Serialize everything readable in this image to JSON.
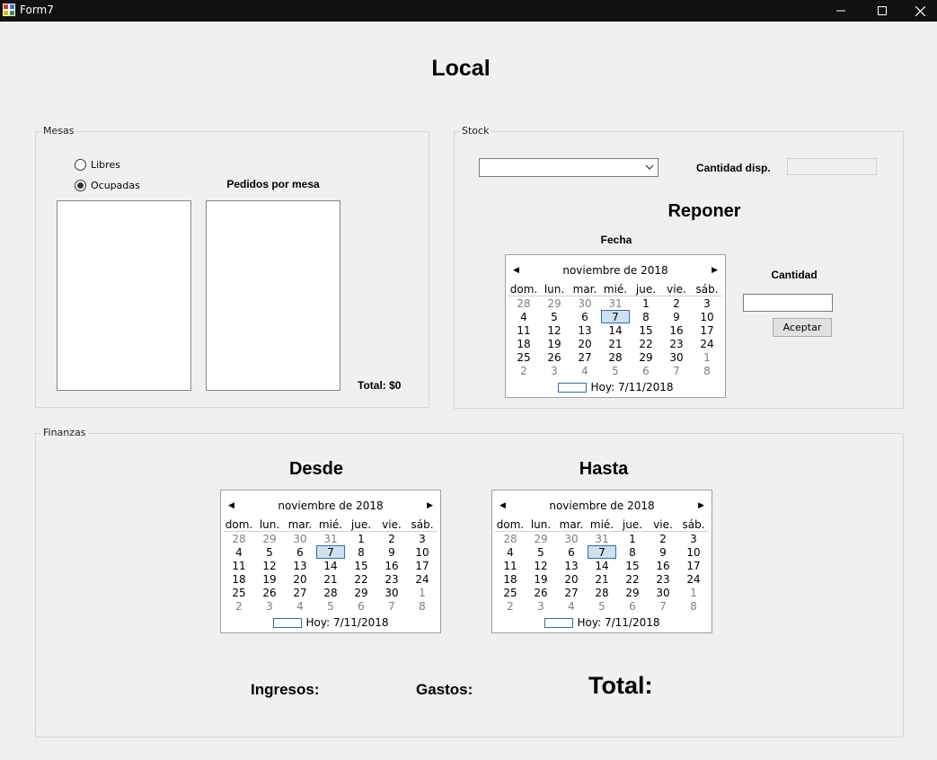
{
  "window": {
    "title": "Form7",
    "minimize_glyph": "—",
    "maximize_glyph": "☐",
    "close_glyph": "✕"
  },
  "page": {
    "heading": "Local"
  },
  "mesas": {
    "group_label": "Mesas",
    "radio_libres": "Libres",
    "radio_ocupadas": "Ocupadas",
    "selected": "Ocupadas",
    "pedidos_label": "Pedidos por mesa",
    "total_label": "Total: $0"
  },
  "stock": {
    "group_label": "Stock",
    "product_value": "",
    "cantidad_disp_label": "Cantidad disp.",
    "cantidad_disp_value": "",
    "reponer_heading": "Reponer",
    "fecha_label": "Fecha",
    "cantidad_label": "Cantidad",
    "cantidad_value": "",
    "aceptar_label": "Aceptar"
  },
  "finanzas": {
    "group_label": "Finanzas",
    "desde_heading": "Desde",
    "hasta_heading": "Hasta",
    "ingresos_label": "Ingresos:",
    "gastos_label": "Gastos:",
    "total_label": "Total:"
  },
  "calendar": {
    "month_label": "noviembre de 2018",
    "weekdays": [
      "dom.",
      "lun.",
      "mar.",
      "mié.",
      "jue.",
      "vie.",
      "sáb."
    ],
    "days": [
      {
        "d": "28",
        "other": true
      },
      {
        "d": "29",
        "other": true
      },
      {
        "d": "30",
        "other": true
      },
      {
        "d": "31",
        "other": true
      },
      {
        "d": "1"
      },
      {
        "d": "2"
      },
      {
        "d": "3"
      },
      {
        "d": "4"
      },
      {
        "d": "5"
      },
      {
        "d": "6"
      },
      {
        "d": "7",
        "today": true
      },
      {
        "d": "8"
      },
      {
        "d": "9"
      },
      {
        "d": "10"
      },
      {
        "d": "11"
      },
      {
        "d": "12"
      },
      {
        "d": "13"
      },
      {
        "d": "14"
      },
      {
        "d": "15"
      },
      {
        "d": "16"
      },
      {
        "d": "17"
      },
      {
        "d": "18"
      },
      {
        "d": "19"
      },
      {
        "d": "20"
      },
      {
        "d": "21"
      },
      {
        "d": "22"
      },
      {
        "d": "23"
      },
      {
        "d": "24"
      },
      {
        "d": "25"
      },
      {
        "d": "26"
      },
      {
        "d": "27"
      },
      {
        "d": "28"
      },
      {
        "d": "29"
      },
      {
        "d": "30"
      },
      {
        "d": "1",
        "other": true
      },
      {
        "d": "2",
        "other": true
      },
      {
        "d": "3",
        "other": true
      },
      {
        "d": "4",
        "other": true
      },
      {
        "d": "5",
        "other": true
      },
      {
        "d": "6",
        "other": true
      },
      {
        "d": "7",
        "other": true
      },
      {
        "d": "8",
        "other": true
      }
    ],
    "today_label": "Hoy: 7/11/2018",
    "prev_glyph": "◀",
    "next_glyph": "▶"
  },
  "icons": {
    "app": "app-icon",
    "combo_arrow": "chevron-down-icon"
  },
  "colors": {
    "titlebar": "#111111",
    "window_bg": "#f0f0f0",
    "today_highlight": "#cfe0ef",
    "today_border": "#2a6db0"
  }
}
